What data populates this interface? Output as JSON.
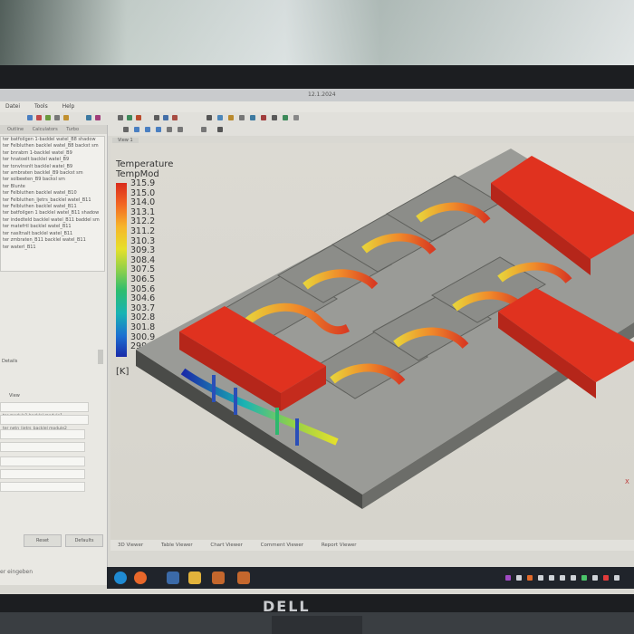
{
  "window": {
    "title": "12.1.2024"
  },
  "menu": {
    "items": [
      "Datei",
      "Tools",
      "Help"
    ]
  },
  "left_panel": {
    "tabs": [
      "Outline",
      "Calculators",
      "Turbo"
    ],
    "tree_items": [
      "ter batfoilgen 1-baddel watel_B8 shadow",
      "ter Felbluthen backlel watel_B8 backst sm",
      "ter bnrabm 1-backlel watel_B9",
      "ter hnatoelt backlel watel_B9",
      "ter tonvlnsnlt backlel watel_B9",
      "ter ambraten backlel_B9 backst sm",
      "ter solbeeten_B9 backsl sm",
      "ter Blunte",
      "ter Felbluthen backlel watel_B10",
      "ter Felbluthen_ljetrs_backlel watel_B11",
      "ter Felbluthen backlel watel_B11",
      "ter batfoilgen 1 backlel watel_B11 shadow",
      "ter indedteld backlel watel_B11 baddel sm",
      "ter matefrtl backlel watel_B11",
      "ter nasltnalt backlel watel_B11",
      "ter zmbraten_B11 backlel watel_B11",
      "ter waterl_B11"
    ],
    "section_label": "Details",
    "props_header": "View",
    "prop_values": [
      "ter module1 backlel module1",
      "ter netn_ljetrs_backlel module2"
    ],
    "reset_label": "Reset",
    "defaults_label": "Defaults",
    "status": "er eingeben"
  },
  "viewport": {
    "tab": "View 1",
    "legend": {
      "title": "Temperature",
      "variable": "TempMod",
      "unit": "[K]",
      "ticks": [
        "315.9",
        "315.0",
        "314.0",
        "313.1",
        "312.2",
        "311.2",
        "310.3",
        "309.3",
        "308.4",
        "307.5",
        "306.5",
        "305.6",
        "304.6",
        "303.7",
        "302.8",
        "301.8",
        "300.9",
        "299.9"
      ]
    },
    "axis_label": "X",
    "bottom_tabs": [
      "3D Viewer",
      "Table Viewer",
      "Chart Viewer",
      "Comment Viewer",
      "Report Viewer"
    ]
  },
  "colors": {
    "hot": "#e0321f",
    "cold": "#1a2aa8",
    "housing": "#8e8f8c",
    "background": "#d9d8d2"
  },
  "monitor": {
    "brand": "DELL"
  }
}
